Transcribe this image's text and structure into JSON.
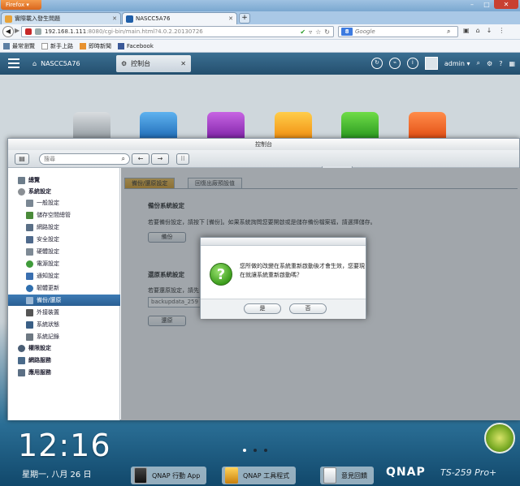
{
  "browser": {
    "menu_label": "Firefox",
    "tabs": [
      {
        "title": "實際載入發生問題"
      },
      {
        "title": "NASCC5A76"
      }
    ],
    "url_host": "192.168.1.111",
    "url_path": ":8080/cgi-bin/main.html?4.0.2.20130726",
    "search_placeholder": "Google",
    "bookmarks": [
      "最常瀏覽",
      "新手上路",
      "即時新聞",
      "Facebook"
    ]
  },
  "qnap_bar": {
    "home_tab": "NASCC5A76",
    "control_tab": "控制台",
    "user": "admin"
  },
  "control_panel": {
    "window_title": "控制台",
    "search_placeholder": "搜尋",
    "sidebar": [
      {
        "label": "總覽",
        "level": "top"
      },
      {
        "label": "系統設定",
        "level": "top"
      },
      {
        "label": "一般設定",
        "level": "sub"
      },
      {
        "label": "儲存空間總管",
        "level": "sub"
      },
      {
        "label": "網路設定",
        "level": "sub"
      },
      {
        "label": "安全設定",
        "level": "sub"
      },
      {
        "label": "硬體設定",
        "level": "sub"
      },
      {
        "label": "電源設定",
        "level": "sub"
      },
      {
        "label": "通知設定",
        "level": "sub"
      },
      {
        "label": "韌體更新",
        "level": "sub"
      },
      {
        "label": "備份/還原",
        "level": "sub",
        "active": true
      },
      {
        "label": "外接裝置",
        "level": "sub"
      },
      {
        "label": "系統狀態",
        "level": "sub"
      },
      {
        "label": "系統記錄",
        "level": "sub"
      },
      {
        "label": "權限設定",
        "level": "top"
      },
      {
        "label": "網路服務",
        "level": "top"
      },
      {
        "label": "應用服務",
        "level": "top"
      }
    ],
    "tabs": [
      "備份/還原設定",
      "回復出廠預設值"
    ],
    "backup": {
      "title": "備份系統設定",
      "text": "若要備份設定，請按下 [備份]。如果系統詢問您要開啟或是儲存備份檔案福，請選擇儲存。",
      "button": "備份"
    },
    "restore": {
      "title": "還原系統設定",
      "text": "若要還原設定，請先",
      "file_value": "backupdata_259",
      "button": "還原"
    }
  },
  "dialog": {
    "message": "您所做的改變在系統重新啟動後才會生效，您要現在就讓系統重新啟動嗎？",
    "yes": "是",
    "no": "否"
  },
  "desktop": {
    "time": "12:16",
    "date": "星期一, 八月 26 日",
    "dock": [
      "QNAP 行動 App",
      "QNAP 工具程式",
      "意見回饋"
    ],
    "brand": "QNAP",
    "model": "TS-259 Pro+"
  }
}
